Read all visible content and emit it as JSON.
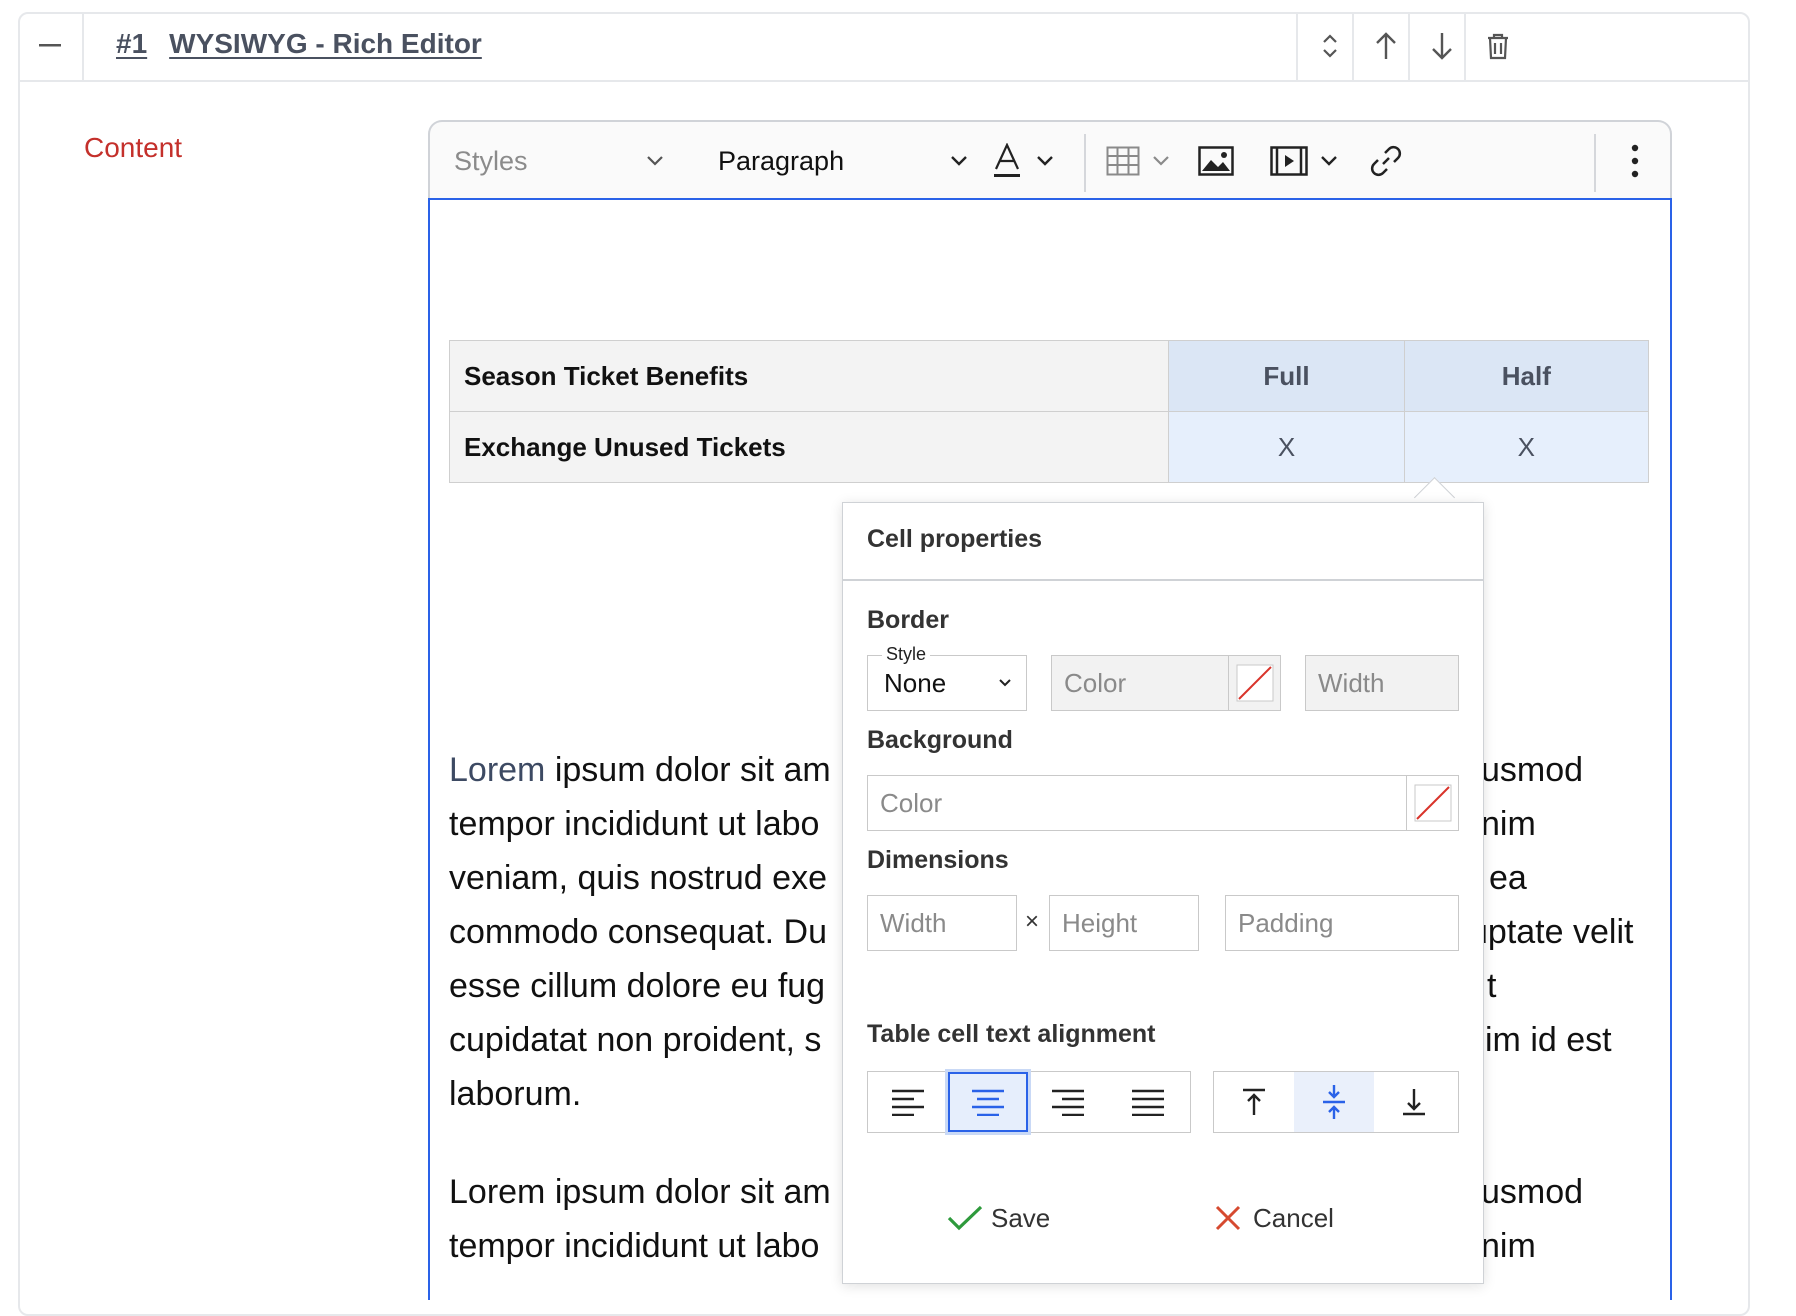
{
  "block": {
    "index": "#1",
    "title": "WYSIWYG - Rich Editor"
  },
  "field": {
    "label": "Content"
  },
  "toolbar": {
    "styles_placeholder": "Styles",
    "heading_value": "Paragraph"
  },
  "table": {
    "header": [
      "Season Ticket Benefits",
      "Full",
      "Half"
    ],
    "rows": [
      [
        "Exchange Unused Tickets",
        "X",
        "X"
      ]
    ]
  },
  "paragraphs": {
    "p1": [
      [
        "Lorem",
        " ipsum dolor sit am",
        "usmod"
      ],
      [
        "tempor incididunt ut labo",
        "nim"
      ],
      [
        "veniam, quis nostrud exe",
        "ea"
      ],
      [
        "commodo consequat. Du",
        "uptate velit"
      ],
      [
        "esse cillum dolore eu fug",
        "t"
      ],
      [
        "cupidatat non proident, s",
        "im id est"
      ],
      [
        "laborum."
      ]
    ],
    "p2": [
      [
        "Lorem ipsum dolor sit am",
        "usmod"
      ],
      [
        "tempor incididunt ut labo",
        "nim"
      ]
    ]
  },
  "cell_properties": {
    "title": "Cell properties",
    "border": {
      "label": "Border",
      "style_label": "Style",
      "style_value": "None",
      "color_placeholder": "Color",
      "width_placeholder": "Width"
    },
    "background": {
      "label": "Background",
      "color_placeholder": "Color"
    },
    "dimensions": {
      "label": "Dimensions",
      "width_placeholder": "Width",
      "times": "×",
      "height_placeholder": "Height",
      "padding_placeholder": "Padding"
    },
    "alignment": {
      "label": "Table cell text alignment"
    },
    "save_label": "Save",
    "cancel_label": "Cancel"
  },
  "colors": {
    "accent": "#2a62e8",
    "label_red": "#c4302b",
    "save_green": "#2e9a3c",
    "cancel_red": "#d64a30"
  }
}
